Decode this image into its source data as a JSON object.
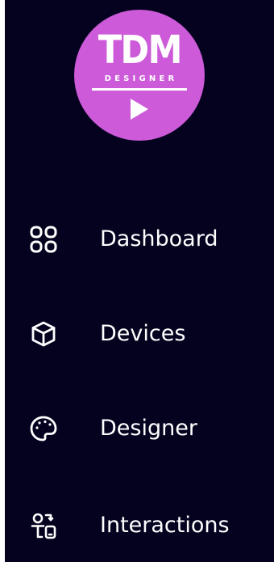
{
  "logo": {
    "title": "TDM",
    "subtitle": "DESIGNER",
    "color": "#cc5ad9",
    "icon": "play-icon"
  },
  "sidebar": {
    "background": "#04021f",
    "items": [
      {
        "label": "Dashboard",
        "icon": "dashboard-grid-icon"
      },
      {
        "label": "Devices",
        "icon": "cube-icon"
      },
      {
        "label": "Designer",
        "icon": "palette-icon"
      },
      {
        "label": "Interactions",
        "icon": "interactions-icon"
      }
    ]
  }
}
